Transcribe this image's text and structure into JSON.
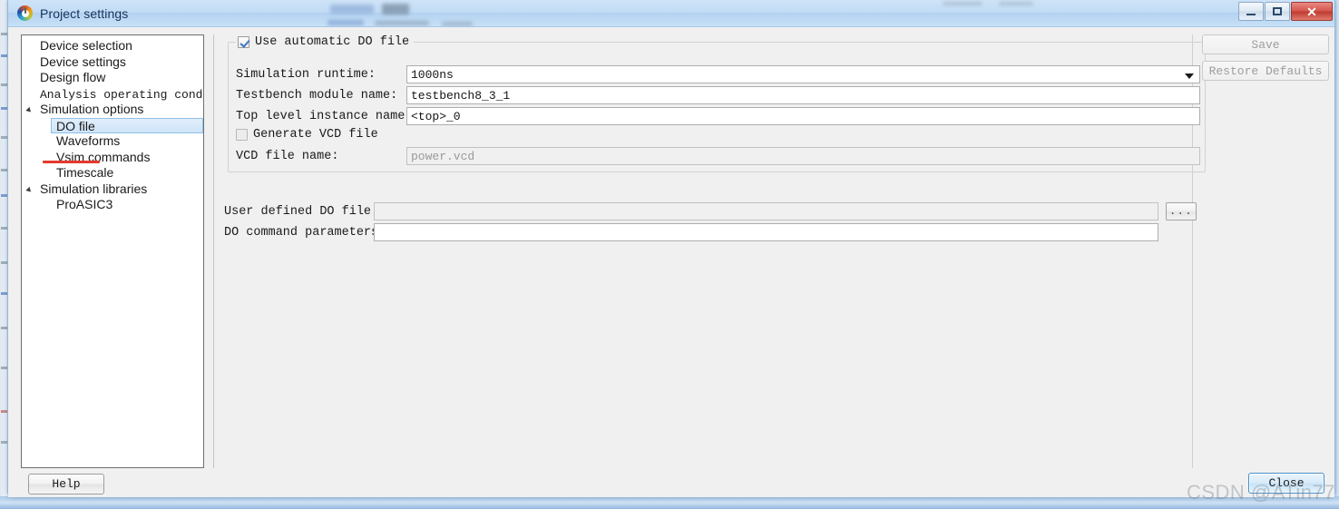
{
  "window": {
    "title": "Project settings",
    "app_icon": "libero-logo-icon",
    "minimize_label": "–",
    "maximize_label": "□",
    "close_label": "✕"
  },
  "sidebar": {
    "items": [
      {
        "label": "Device selection",
        "level": 1,
        "expandable": false,
        "selected": false,
        "mono": false
      },
      {
        "label": "Device settings",
        "level": 1,
        "expandable": false,
        "selected": false,
        "mono": false
      },
      {
        "label": "Design flow",
        "level": 1,
        "expandable": false,
        "selected": false,
        "mono": false
      },
      {
        "label": "Analysis operating condi⋯",
        "level": 1,
        "expandable": false,
        "selected": false,
        "mono": true
      },
      {
        "label": "Simulation options",
        "level": 0,
        "expandable": true,
        "selected": false,
        "mono": false
      },
      {
        "label": "DO file",
        "level": 2,
        "expandable": false,
        "selected": true,
        "mono": false
      },
      {
        "label": "Waveforms",
        "level": 2,
        "expandable": false,
        "selected": false,
        "mono": false
      },
      {
        "label": "Vsim commands",
        "level": 2,
        "expandable": false,
        "selected": false,
        "mono": false
      },
      {
        "label": "Timescale",
        "level": 2,
        "expandable": false,
        "selected": false,
        "mono": false
      },
      {
        "label": "Simulation libraries",
        "level": 0,
        "expandable": true,
        "selected": false,
        "mono": false
      },
      {
        "label": "ProASIC3",
        "level": 2,
        "expandable": false,
        "selected": false,
        "mono": false
      }
    ]
  },
  "form": {
    "use_auto_do_file": {
      "label": "Use automatic DO file",
      "checked": true
    },
    "simulation_runtime": {
      "label": "Simulation runtime:",
      "value": "1000ns"
    },
    "testbench_module_name": {
      "label": "Testbench module name:",
      "value": "testbench8_3_1"
    },
    "top_level_instance_name": {
      "label": "Top level instance name:",
      "value": "<top>_0"
    },
    "generate_vcd_file": {
      "label": "Generate VCD file",
      "checked": false
    },
    "vcd_file_name": {
      "label": "VCD file name:",
      "value": "power.vcd",
      "disabled": true
    },
    "user_defined_do_file": {
      "label": "User defined DO file:",
      "value": "",
      "disabled": true,
      "browse_label": "..."
    },
    "do_command_parameters": {
      "label": "DO command parameters:",
      "value": "",
      "disabled": false
    }
  },
  "buttons": {
    "save": "Save",
    "restore_defaults": "Restore Defaults",
    "help": "Help",
    "close": "Close"
  },
  "watermark": {
    "text": "CSDN @ATin77"
  },
  "colors": {
    "accent_blue": "#4a90c8",
    "annotation_red": "#e23a2e",
    "titlebar_blue": "#c2dcf5",
    "selection_blue": "#cfe4f8"
  }
}
